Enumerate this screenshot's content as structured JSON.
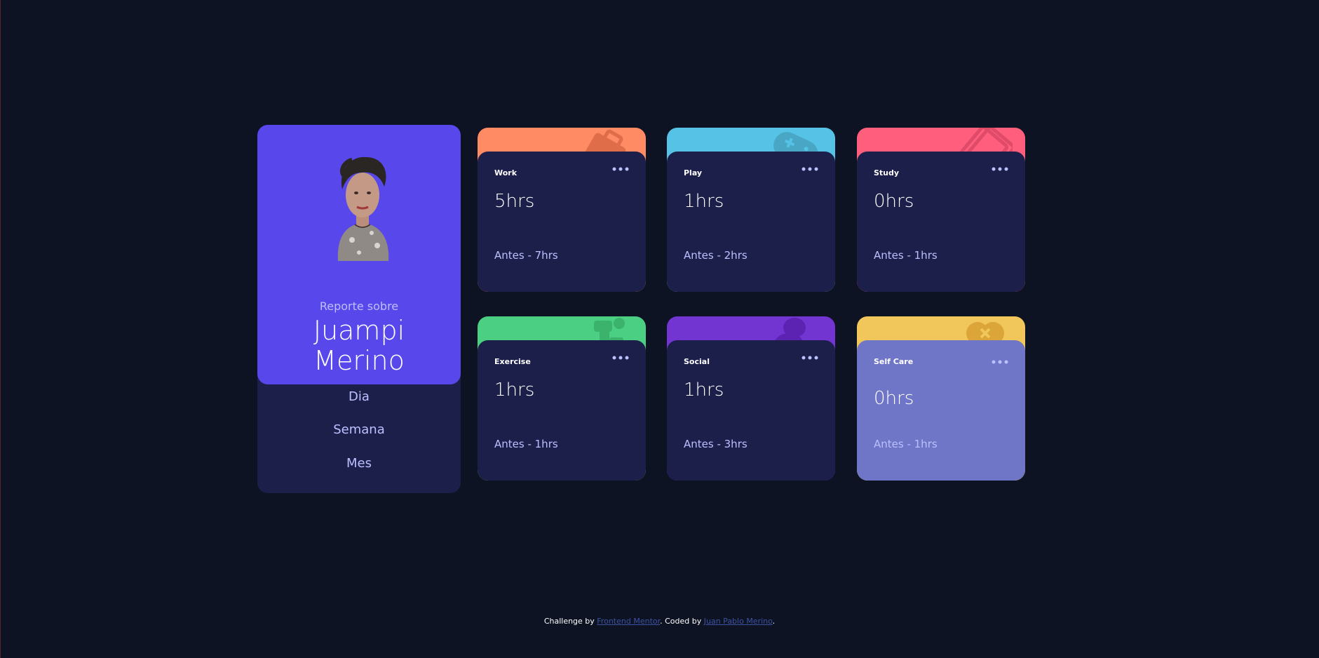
{
  "profile": {
    "report_label": "Reporte sobre",
    "name_first": "Juampi",
    "name_last": "Merino",
    "periods": [
      "Dia",
      "Semana",
      "Mes"
    ]
  },
  "colors": {
    "background": "#0e1323",
    "card_body": "#1c1f4a",
    "profile_top": "#5847eb",
    "muted_text": "#bbc0ff",
    "work": "#ff8b64",
    "play": "#55c2e6",
    "study": "#ff5e7d",
    "exercise": "#4bcf82",
    "social": "#7335d2",
    "self_care": "#f1c75b"
  },
  "cards": [
    {
      "title": "Work",
      "current": "5hrs",
      "previous": "Antes - 7hrs",
      "icon": "briefcase-icon"
    },
    {
      "title": "Play",
      "current": "1hrs",
      "previous": "Antes - 2hrs",
      "icon": "gamepad-icon"
    },
    {
      "title": "Study",
      "current": "0hrs",
      "previous": "Antes - 1hrs",
      "icon": "books-icon"
    },
    {
      "title": "Exercise",
      "current": "1hrs",
      "previous": "Antes - 1hrs",
      "icon": "runner-icon"
    },
    {
      "title": "Social",
      "current": "1hrs",
      "previous": "Antes - 3hrs",
      "icon": "chat-bubbles-icon"
    },
    {
      "title": "Self Care",
      "current": "0hrs",
      "previous": "Antes - 1hrs",
      "icon": "heart-icon"
    }
  ],
  "footer": {
    "prefix": "Challenge by ",
    "link1": "Frontend Mentor",
    "middle": ". Coded by ",
    "link2": "Juan Pablo Merino",
    "suffix": "."
  }
}
